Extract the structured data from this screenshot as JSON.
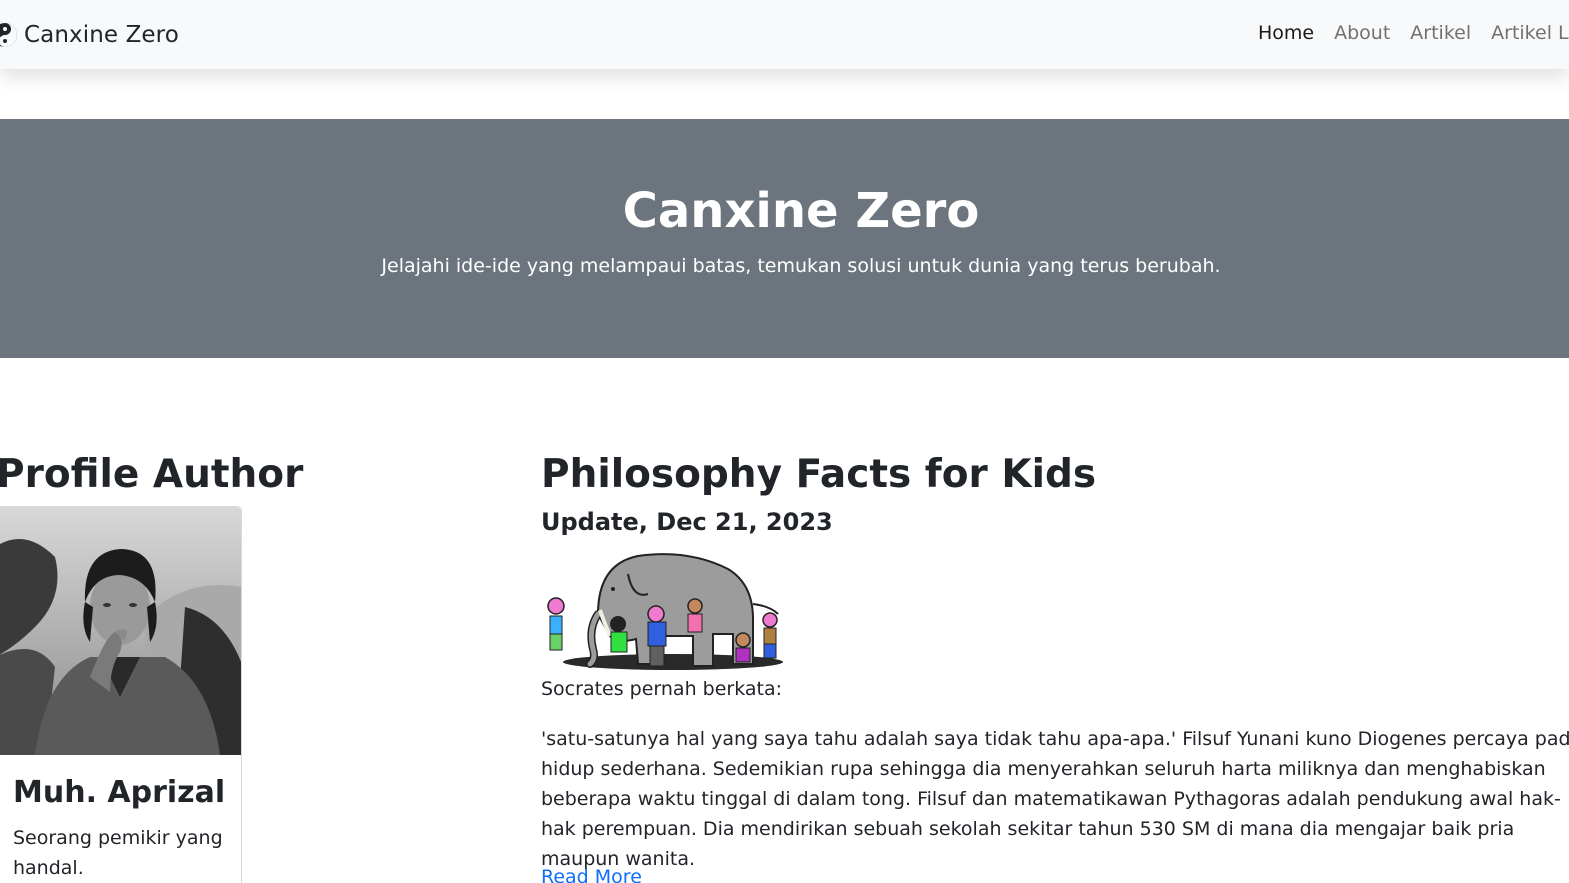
{
  "navbar": {
    "brand_icon": "yin-yang-icon",
    "brand": "Canxine Zero",
    "links": [
      {
        "label": "Home",
        "active": true
      },
      {
        "label": "About",
        "active": false
      },
      {
        "label": "Artikel",
        "active": false
      },
      {
        "label": "Artikel Lain",
        "active": false
      }
    ]
  },
  "hero": {
    "title": "Canxine Zero",
    "subtitle": "Jelajahi ide-ide yang melampaui batas, temukan solusi untuk dunia yang terus berubah."
  },
  "sidebar": {
    "title": "Profile Author",
    "author_name": "Muh. Aprizal",
    "author_bio": "Seorang pemikir yang handal."
  },
  "article": {
    "title": "Philosophy Facts for Kids",
    "date": "Update, Dec 21, 2023",
    "intro": "Socrates pernah berkata:",
    "body": "'satu-satunya hal yang saya tahu adalah saya tidak tahu apa-apa.' Filsuf Yunani kuno Diogenes percaya pada hidup sederhana. Sedemikian rupa sehingga dia menyerahkan seluruh harta miliknya dan menghabiskan beberapa waktu tinggal di dalam tong. Filsuf dan matematikawan Pythagoras adalah pendukung awal hak-hak perempuan. Dia mendirikan sebuah sekolah sekitar tahun 530 SM di mana dia mengajar baik pria maupun wanita.",
    "read_more": "Read More"
  },
  "colors": {
    "navbar_bg": "#f8f9fa",
    "hero_bg": "#6c757d",
    "link": "#0d6efd"
  }
}
